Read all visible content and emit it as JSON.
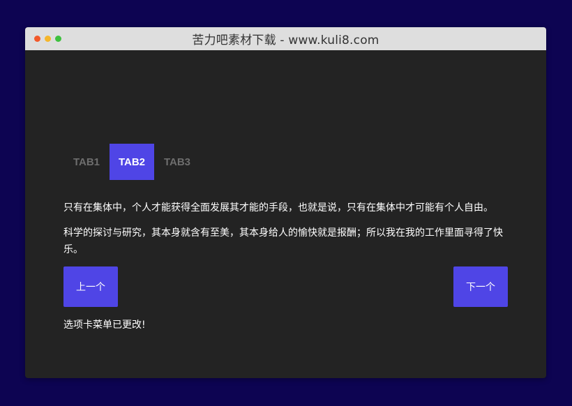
{
  "window": {
    "title": "苦力吧素材下载 - www.kuli8.com"
  },
  "tabs": [
    {
      "label": "TAB1",
      "active": false
    },
    {
      "label": "TAB2",
      "active": true
    },
    {
      "label": "TAB3",
      "active": false
    }
  ],
  "panel": {
    "paragraphs": [
      "只有在集体中，个人才能获得全面发展其才能的手段，也就是说，只有在集体中才可能有个人自由。",
      "科学的探讨与研究，其本身就含有至美，其本身给人的愉快就是报酬；所以我在我的工作里面寻得了快乐。"
    ]
  },
  "controls": {
    "prev_label": "上一个",
    "next_label": "下一个"
  },
  "status": {
    "text": "选项卡菜单已更改!"
  },
  "colors": {
    "background": "#0d0452",
    "window": "#232323",
    "titlebar": "#dedede",
    "accent": "#4f45e6",
    "inactive_tab_text": "#6e6e6e"
  },
  "icons": [
    "close-dot-icon",
    "minimize-dot-icon",
    "maximize-dot-icon"
  ]
}
